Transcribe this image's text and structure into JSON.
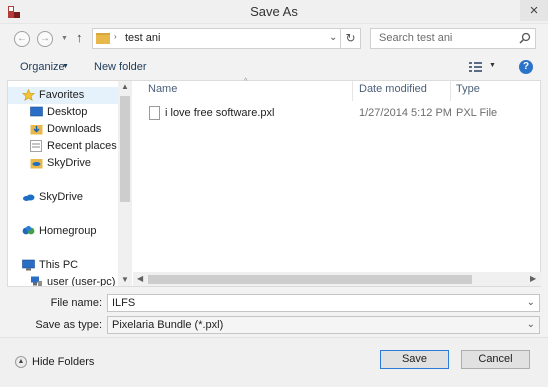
{
  "window": {
    "title": "Save As",
    "close_glyph": "×"
  },
  "address": {
    "current_folder": "test ani",
    "separator": "›"
  },
  "search": {
    "placeholder": "Search test ani"
  },
  "toolbar": {
    "organize_label": "Organize",
    "new_folder_label": "New folder",
    "help_glyph": "?"
  },
  "navigation": [
    {
      "label": "Favorites",
      "icon": "star-icon"
    },
    {
      "label": "Desktop",
      "icon": "desktop-icon"
    },
    {
      "label": "Downloads",
      "icon": "downloads-icon"
    },
    {
      "label": "Recent places",
      "icon": "recent-places-icon"
    },
    {
      "label": "SkyDrive",
      "icon": "skydrive-folder-icon"
    },
    {
      "label": "SkyDrive",
      "icon": "skydrive-cloud-icon"
    },
    {
      "label": "Homegroup",
      "icon": "homegroup-icon"
    },
    {
      "label": "This PC",
      "icon": "computer-icon"
    },
    {
      "label": "user (user-pc)",
      "icon": "network-user-icon"
    }
  ],
  "columns": {
    "name": "Name",
    "date": "Date modified",
    "type": "Type"
  },
  "files": [
    {
      "name": "i love free software.pxl",
      "date": "1/27/2014 5:12 PM",
      "type": "PXL File"
    }
  ],
  "fields": {
    "file_name_label": "File name:",
    "file_name_value": "ILFS",
    "save_type_label": "Save as type:",
    "save_type_value": "Pixelaria Bundle (*.pxl)"
  },
  "footer": {
    "hide_folders_label": "Hide Folders",
    "save_label": "Save",
    "cancel_label": "Cancel"
  },
  "colors": {
    "accent": "#2c7bd6",
    "folder": "#e8b94a",
    "link_text": "#1e3b5a"
  }
}
